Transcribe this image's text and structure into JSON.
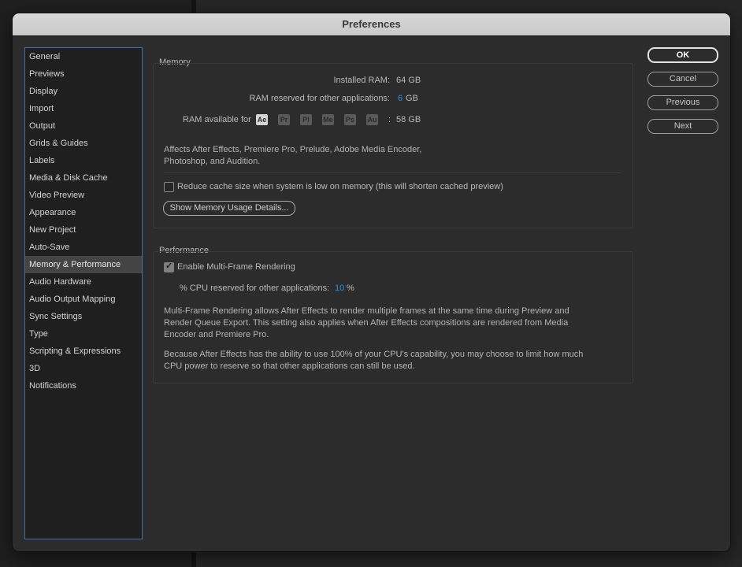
{
  "window": {
    "title": "Preferences"
  },
  "sidebar": {
    "items": [
      {
        "label": "General"
      },
      {
        "label": "Previews"
      },
      {
        "label": "Display"
      },
      {
        "label": "Import"
      },
      {
        "label": "Output"
      },
      {
        "label": "Grids & Guides"
      },
      {
        "label": "Labels"
      },
      {
        "label": "Media & Disk Cache"
      },
      {
        "label": "Video Preview"
      },
      {
        "label": "Appearance"
      },
      {
        "label": "New Project"
      },
      {
        "label": "Auto-Save"
      },
      {
        "label": "Memory & Performance",
        "selected": true
      },
      {
        "label": "Audio Hardware"
      },
      {
        "label": "Audio Output Mapping"
      },
      {
        "label": "Sync Settings"
      },
      {
        "label": "Type"
      },
      {
        "label": "Scripting & Expressions"
      },
      {
        "label": "3D"
      },
      {
        "label": "Notifications"
      }
    ]
  },
  "memory": {
    "group_label": "Memory",
    "installed_ram_label": "Installed RAM:",
    "installed_ram_value": "64 GB",
    "reserved_label": "RAM reserved for other applications:",
    "reserved_value": "6",
    "reserved_unit": "GB",
    "available_label": "RAM available for",
    "apps": [
      "Ae",
      "Pr",
      "Pl",
      "Me",
      "Ps",
      "Au"
    ],
    "available_colon": ":",
    "available_value": "58 GB",
    "description_line1": "Affects After Effects, Premiere Pro, Prelude, Adobe Media Encoder,",
    "description_line2": "Photoshop, and Audition.",
    "reduce_cache_label": "Reduce cache size when system is low on memory (this will shorten cached preview)",
    "reduce_cache_checked": false,
    "details_button": "Show Memory Usage Details..."
  },
  "performance": {
    "group_label": "Performance",
    "mfr_label": "Enable Multi-Frame Rendering",
    "mfr_checked": true,
    "cpu_label": "% CPU reserved for other applications:",
    "cpu_value": "10",
    "cpu_unit": "%",
    "para1_line1": "Multi-Frame Rendering allows After Effects to render multiple frames at the same time during Preview and",
    "para1_line2": "Render Queue Export. This setting also applies when After Effects compositions are rendered from Media",
    "para1_line3": "Encoder and Premiere Pro.",
    "para2_line1": "Because After Effects has the ability to use 100% of your CPU's capability, you may choose to limit how much",
    "para2_line2": "CPU power to reserve so that other applications can still be used."
  },
  "buttons": {
    "ok": "OK",
    "cancel": "Cancel",
    "previous": "Previous",
    "next": "Next"
  },
  "colors": {
    "accent_blue": "#2f8ee0",
    "sidebar_border": "#3e6fae",
    "selected_row": "#444444"
  }
}
